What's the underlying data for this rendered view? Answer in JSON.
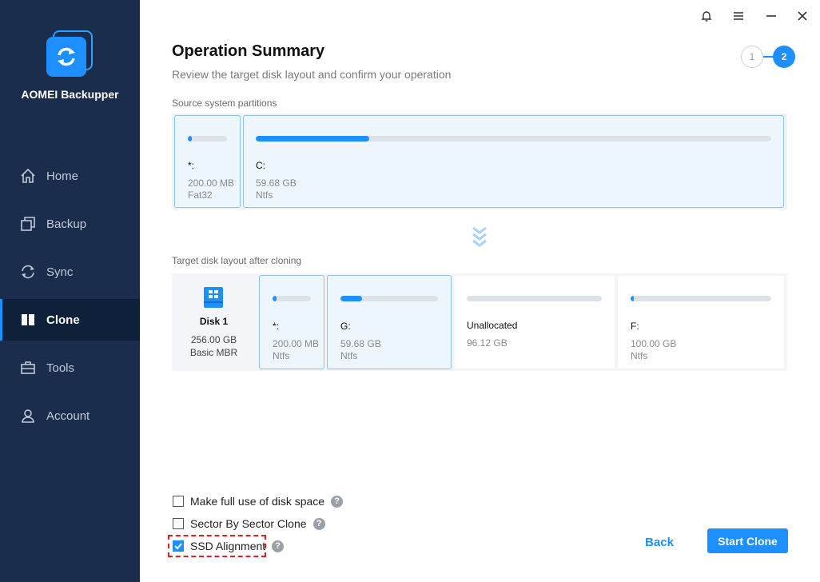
{
  "app": {
    "name": "AOMEI Backupper"
  },
  "sidebar": {
    "items": [
      {
        "label": "Home",
        "icon": "home-icon"
      },
      {
        "label": "Backup",
        "icon": "backup-icon"
      },
      {
        "label": "Sync",
        "icon": "sync-icon"
      },
      {
        "label": "Clone",
        "icon": "clone-icon",
        "active": true
      },
      {
        "label": "Tools",
        "icon": "tools-icon"
      },
      {
        "label": "Account",
        "icon": "account-icon"
      }
    ]
  },
  "header": {
    "title": "Operation Summary",
    "subtitle": "Review the target disk layout and confirm your operation",
    "steps": [
      "1",
      "2"
    ],
    "current_step": 2
  },
  "source": {
    "label": "Source system partitions",
    "partitions": [
      {
        "name": "*:",
        "size": "200.00 MB",
        "fs": "Fat32",
        "used_fraction": 0.1
      },
      {
        "name": "C:",
        "size": "59.68 GB",
        "fs": "Ntfs",
        "used_fraction": 0.22
      }
    ]
  },
  "target": {
    "label": "Target disk layout after cloning",
    "disk": {
      "name": "Disk 1",
      "capacity": "256.00 GB",
      "type": "Basic MBR"
    },
    "partitions": [
      {
        "name": "*:",
        "size": "200.00 MB",
        "fs": "Ntfs",
        "used_fraction": 0.1
      },
      {
        "name": "G:",
        "size": "59.68 GB",
        "fs": "Ntfs",
        "used_fraction": 0.22
      },
      {
        "name": "Unallocated",
        "size": "96.12 GB",
        "fs": "",
        "used_fraction": 0
      },
      {
        "name": "F:",
        "size": "100.00 GB",
        "fs": "Ntfs",
        "used_fraction": 0.02
      }
    ]
  },
  "options": [
    {
      "label": "Make full use of disk space",
      "checked": false
    },
    {
      "label": "Sector By Sector Clone",
      "checked": false
    },
    {
      "label": "SSD Alignment",
      "checked": true
    }
  ],
  "help_symbol": "?",
  "buttons": {
    "back": "Back",
    "start": "Start Clone"
  },
  "colors": {
    "accent": "#1e8fff",
    "sidebar": "#1a2d4d",
    "highlight": "#e02020"
  }
}
